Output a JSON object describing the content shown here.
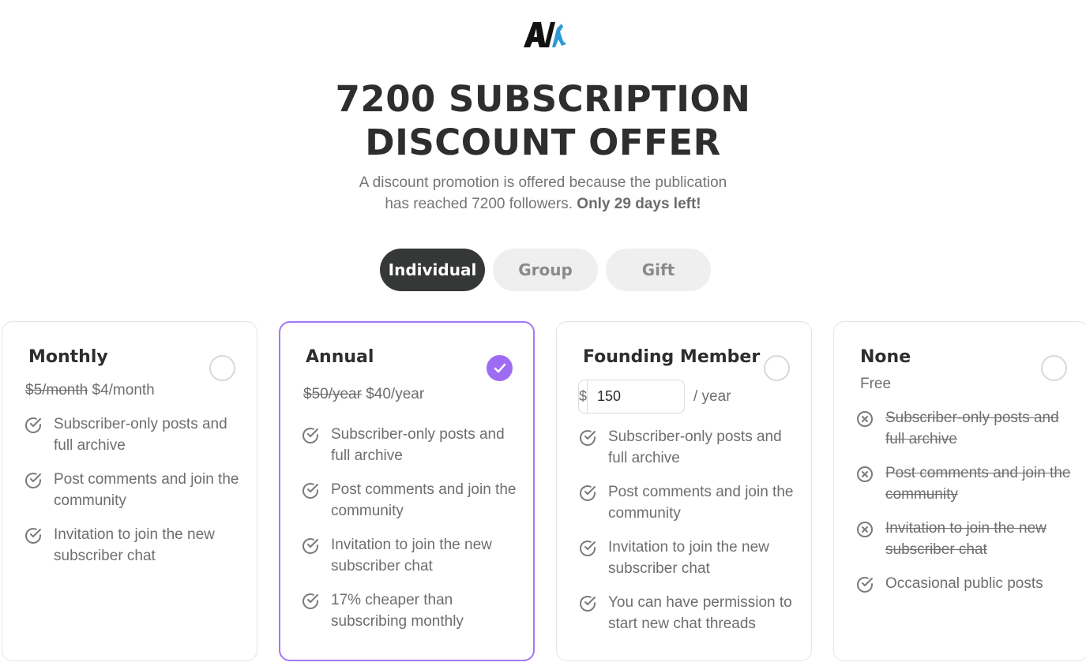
{
  "logo": {
    "text": "AI",
    "icon": "publication-logo"
  },
  "headline": {
    "line1": "7200 SUBSCRIPTION",
    "line2": "DISCOUNT OFFER"
  },
  "subtitle": {
    "line1": "A discount promotion is offered because the publication",
    "line2_prefix": "has reached 7200 followers. ",
    "line2_bold": "Only 29 days left!"
  },
  "tabs": [
    {
      "label": "Individual",
      "active": true
    },
    {
      "label": "Group",
      "active": false
    },
    {
      "label": "Gift",
      "active": false
    }
  ],
  "plans": {
    "monthly": {
      "title": "Monthly",
      "old_price": "$5/month",
      "new_price": "$4/month",
      "selected": false,
      "features": [
        "Subscriber-only posts and full archive",
        "Post comments and join the community",
        "Invitation to join the new subscriber chat"
      ]
    },
    "annual": {
      "title": "Annual",
      "old_price": "$50/year",
      "new_price": "$40/year",
      "selected": true,
      "features": [
        "Subscriber-only posts and full archive",
        "Post comments and join the community",
        "Invitation to join the new subscriber chat",
        "17% cheaper than subscribing monthly"
      ]
    },
    "founding": {
      "title": "Founding Member",
      "currency": "$",
      "amount": "150",
      "period": "/ year",
      "selected": false,
      "features": [
        "Subscriber-only posts and full archive",
        "Post comments and join the community",
        "Invitation to join the new subscriber chat",
        "You can have permission to start new chat threads"
      ]
    },
    "none": {
      "title": "None",
      "price": "Free",
      "selected": false,
      "excluded_features": [
        "Subscriber-only posts and full archive",
        "Post comments and join the community",
        "Invitation to join the new subscriber chat"
      ],
      "features": [
        "Occasional public posts"
      ]
    }
  },
  "colors": {
    "accent": "#9d6cf3",
    "selected_border": "#a377f5",
    "active_tab": "#363737",
    "inactive_tab": "#efefef",
    "logo_blue": "#2e9ad6"
  }
}
